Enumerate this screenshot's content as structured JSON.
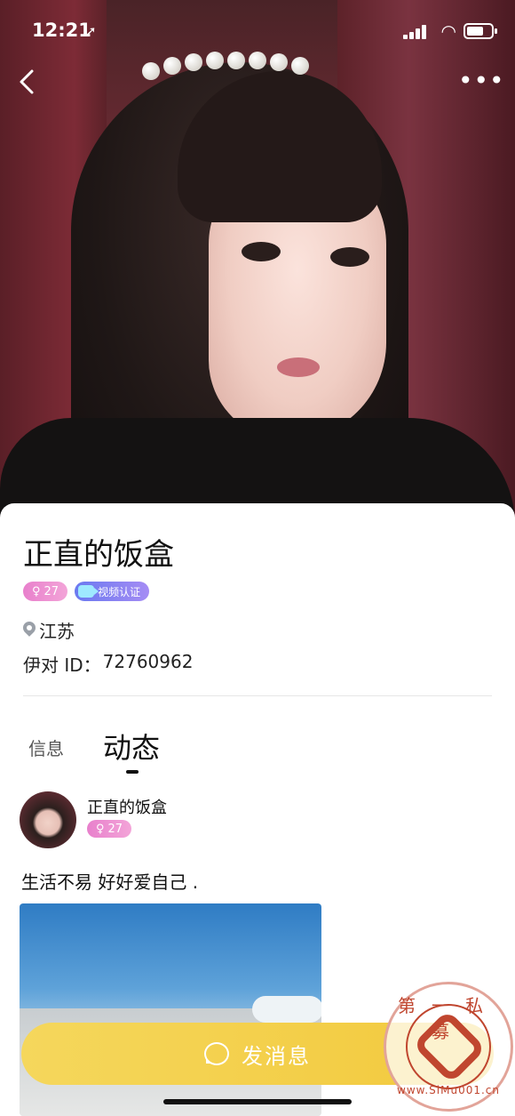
{
  "status_bar": {
    "time": "12:21",
    "location_icon": "location-arrow-icon",
    "signal_icon": "cellular-signal-icon",
    "wifi_icon": "wifi-icon",
    "battery_icon": "battery-icon"
  },
  "nav": {
    "back_icon": "chevron-left-icon",
    "more_label": "•••"
  },
  "profile": {
    "name": "正直的饭盒",
    "level": "27",
    "video_badge": "视频认证",
    "location": "江苏",
    "id_label": "伊对 ID：",
    "id_value": "72760962"
  },
  "tabs": [
    {
      "label": "信息",
      "active": false
    },
    {
      "label": "动态",
      "active": true
    }
  ],
  "post": {
    "author": "正直的饭盒",
    "level": "27",
    "text": "生活不易 好好爱自己 ."
  },
  "action": {
    "message_label": "发消息",
    "icon": "chat-bubble-icon"
  },
  "watermark": {
    "top": "第一私募",
    "bottom": "www.SiMu001.cn"
  },
  "colors": {
    "primary_button": "#F2C93C",
    "level_badge": "#E880CC",
    "video_badge": "#6A79F0"
  }
}
